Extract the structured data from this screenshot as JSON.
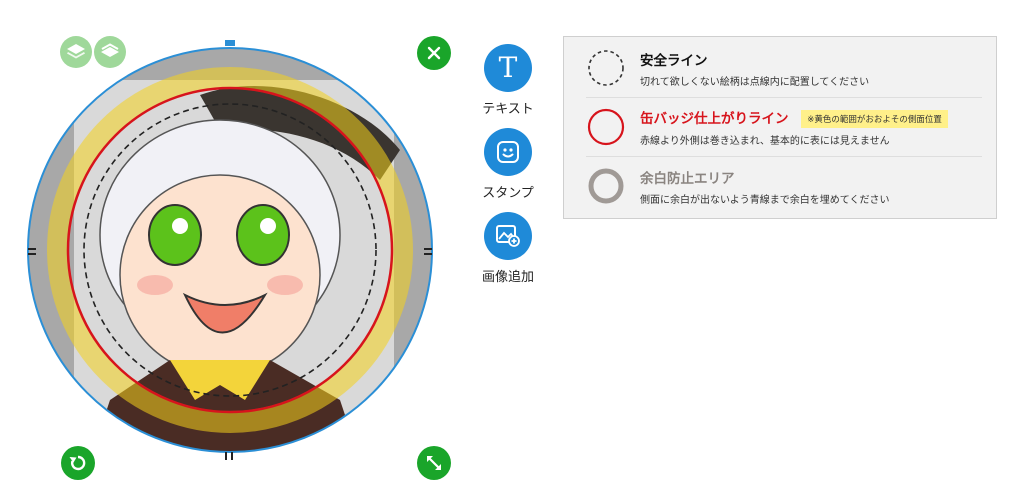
{
  "tools": [
    {
      "id": "text",
      "label": "テキスト",
      "icon": "text-t-icon"
    },
    {
      "id": "stamp",
      "label": "スタンプ",
      "icon": "smiley-stamp-icon"
    },
    {
      "id": "image",
      "label": "画像追加",
      "icon": "add-image-icon"
    }
  ],
  "legend": {
    "safe_line": {
      "title": "安全ライン",
      "desc": "切れて欲しくない絵柄は点線内に配置してください",
      "color": "#333333"
    },
    "finish_line": {
      "title": "缶バッジ仕上がりライン",
      "note": "※黄色の範囲がおおよその側面位置",
      "desc": "赤線より外側は巻き込まれ、基本的に表には見えません",
      "color": "#d7141c"
    },
    "margin_area": {
      "title": "余白防止エリア",
      "desc": "側面に余白が出ないよう青線まで余白を埋めてください",
      "color": "#a09a96"
    }
  },
  "editor": {
    "layer_buttons": [
      "layers-up-icon",
      "layers-down-icon"
    ],
    "close_icon": "close-icon",
    "rotate_icon": "rotate-icon",
    "resize_icon": "resize-arrows-icon",
    "colors": {
      "accent_green": "#1aa52a",
      "tool_blue": "#1f8ad8",
      "outer_line": "#2b8fd6",
      "side_band": "#f4d21c",
      "finish_line": "#d7141c"
    }
  }
}
